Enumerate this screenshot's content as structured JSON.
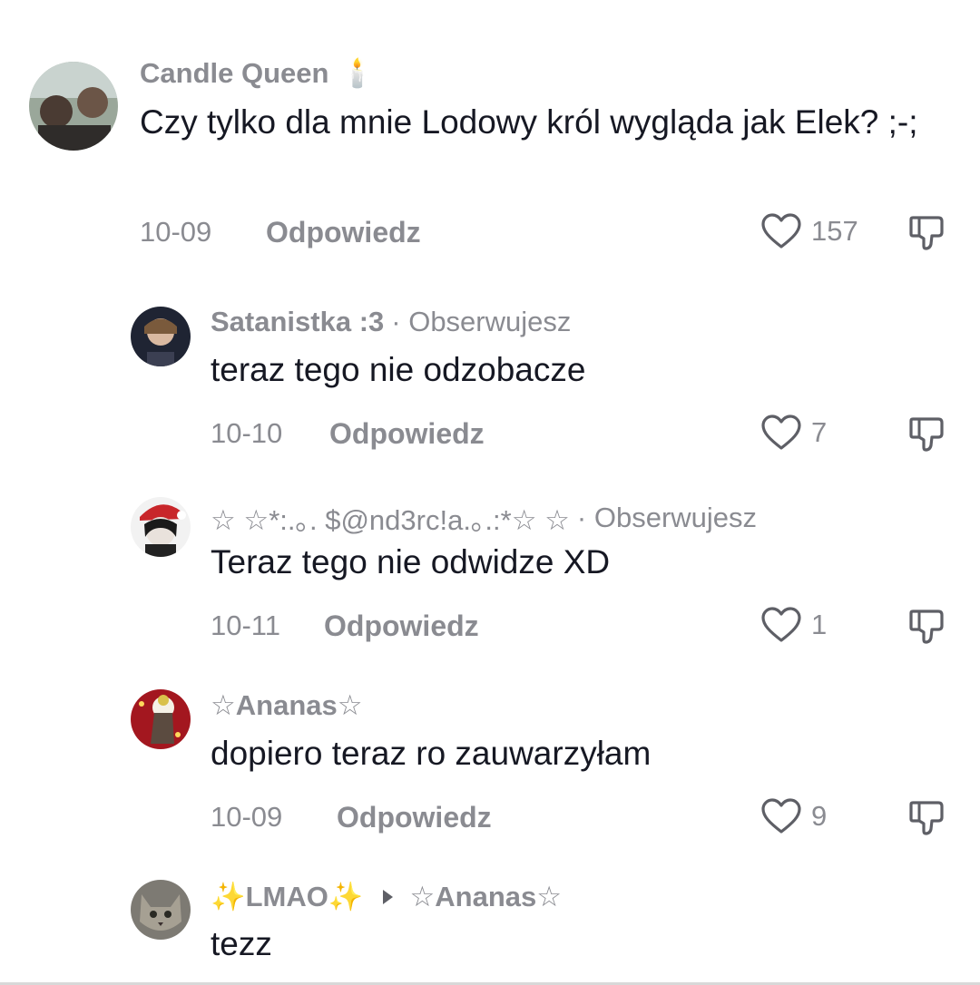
{
  "comments": [
    {
      "username": "Candle Queen",
      "badge": "🕯️",
      "text": "Czy tylko dla mnie Lodowy król wygląda jak Elek? ;-;",
      "date": "10-09",
      "reply_label": "Odpowiedz",
      "likes": "157"
    },
    {
      "username": "Satanistka :3",
      "follow": "· Obserwujesz",
      "text": "teraz tego nie odzobacze",
      "date": "10-10",
      "reply_label": "Odpowiedz",
      "likes": "7"
    },
    {
      "username": "☆ ☆*:.｡. $@nd3rc!a.｡.:*☆ ☆",
      "follow": "· Obserwujesz",
      "text": "Teraz tego nie odwidze XD",
      "date": "10-11",
      "reply_label": "Odpowiedz",
      "likes": "1"
    },
    {
      "username": "☆Ananas☆",
      "text": "dopiero teraz ro zauwarzyłam",
      "date": "10-09",
      "reply_label": "Odpowiedz",
      "likes": "9"
    },
    {
      "username": "✨LMAO✨",
      "reply_to": "☆Ananas☆",
      "text": "tezz"
    }
  ],
  "icons": {
    "like": "heart-outline-icon",
    "dislike": "thumbs-down-icon",
    "reply_to": "triangle-right-icon"
  }
}
